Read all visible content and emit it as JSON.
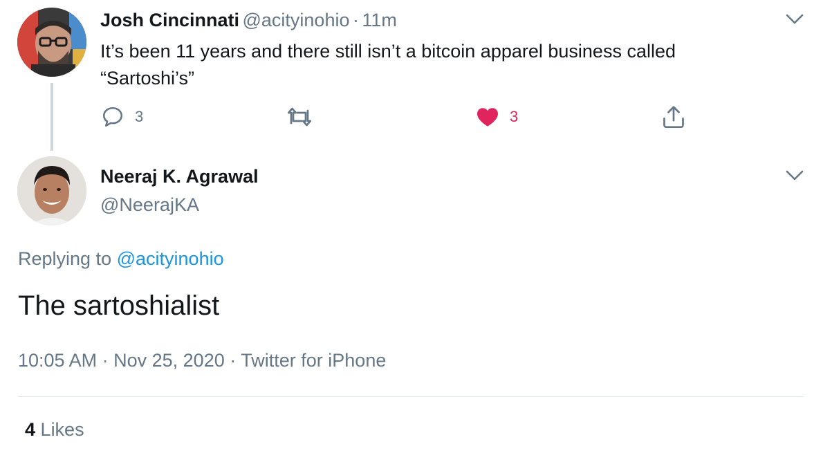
{
  "tweet1": {
    "name": "Josh Cincinnati",
    "handle": "@acityinohio",
    "separator": "·",
    "time": "11m",
    "text_line1": "It’s been 11 years and there still isn’t a bitcoin apparel business called",
    "text_line2": "“Sartoshi’s”",
    "reply_count": "3",
    "like_count": "3",
    "icons": {
      "reply": "reply-icon",
      "retweet": "retweet-icon",
      "like": "heart-icon",
      "share": "share-icon",
      "menu": "chevron-down-icon"
    },
    "like_color": "#e0245e"
  },
  "tweet2": {
    "name": "Neeraj K. Agrawal",
    "handle": "@NeerajKA",
    "replying_prefix": "Replying to",
    "replying_mention": "@acityinohio",
    "text": "The sartoshialist",
    "time": "10:05 AM",
    "date": "Nov 25, 2020",
    "source": "Twitter for iPhone",
    "meta_separator": "·",
    "likes_count": "4",
    "likes_label": "Likes"
  },
  "colors": {
    "link": "#1b95e0",
    "secondary_text": "#657786",
    "primary_text": "#14171a"
  }
}
